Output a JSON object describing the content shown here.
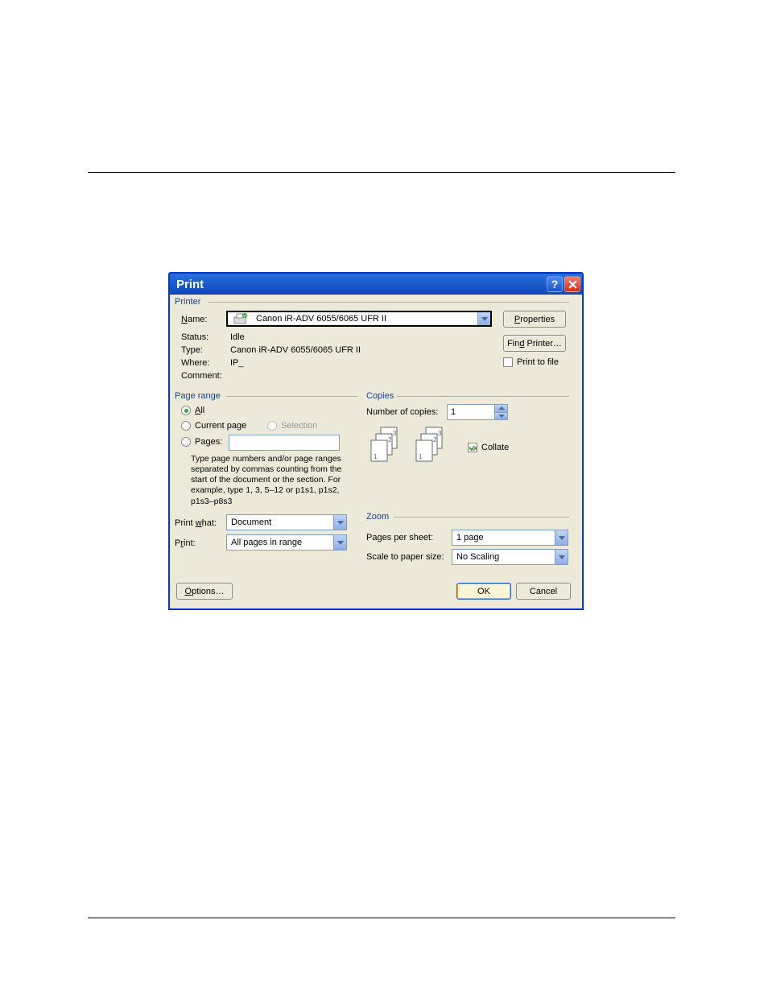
{
  "titlebar": {
    "title": "Print"
  },
  "printer": {
    "group_label": "Printer",
    "name_label": "Name:",
    "name_value": "Canon iR-ADV 6055/6065 UFR II",
    "status_label": "Status:",
    "status_value": "Idle",
    "type_label": "Type:",
    "type_value": "Canon iR-ADV 6055/6065 UFR II",
    "where_label": "Where:",
    "where_value": "IP_",
    "comment_label": "Comment:",
    "properties_btn": "Properties",
    "find_printer_btn": "Find Printer…",
    "print_to_file_label": "Print to file"
  },
  "page_range": {
    "group_label": "Page range",
    "all_label": "All",
    "current_label": "Current page",
    "selection_label": "Selection",
    "pages_label": "Pages:",
    "pages_value": "",
    "hint": "Type page numbers and/or page ranges separated by commas counting from the start of the document or the section. For example, type 1, 3, 5–12 or p1s1, p1s2, p1s3–p8s3",
    "selected": "all"
  },
  "copies": {
    "group_label": "Copies",
    "num_label": "Number of copies:",
    "num_value": "1",
    "collate_label": "Collate",
    "collate_checked": true
  },
  "print_what": {
    "label": "Print what:",
    "value": "Document"
  },
  "print": {
    "label": "Print:",
    "value": "All pages in range"
  },
  "zoom": {
    "group_label": "Zoom",
    "pps_label": "Pages per sheet:",
    "pps_value": "1 page",
    "scale_label": "Scale to paper size:",
    "scale_value": "No Scaling"
  },
  "footer": {
    "options_btn": "Options…",
    "ok_btn": "OK",
    "cancel_btn": "Cancel"
  }
}
